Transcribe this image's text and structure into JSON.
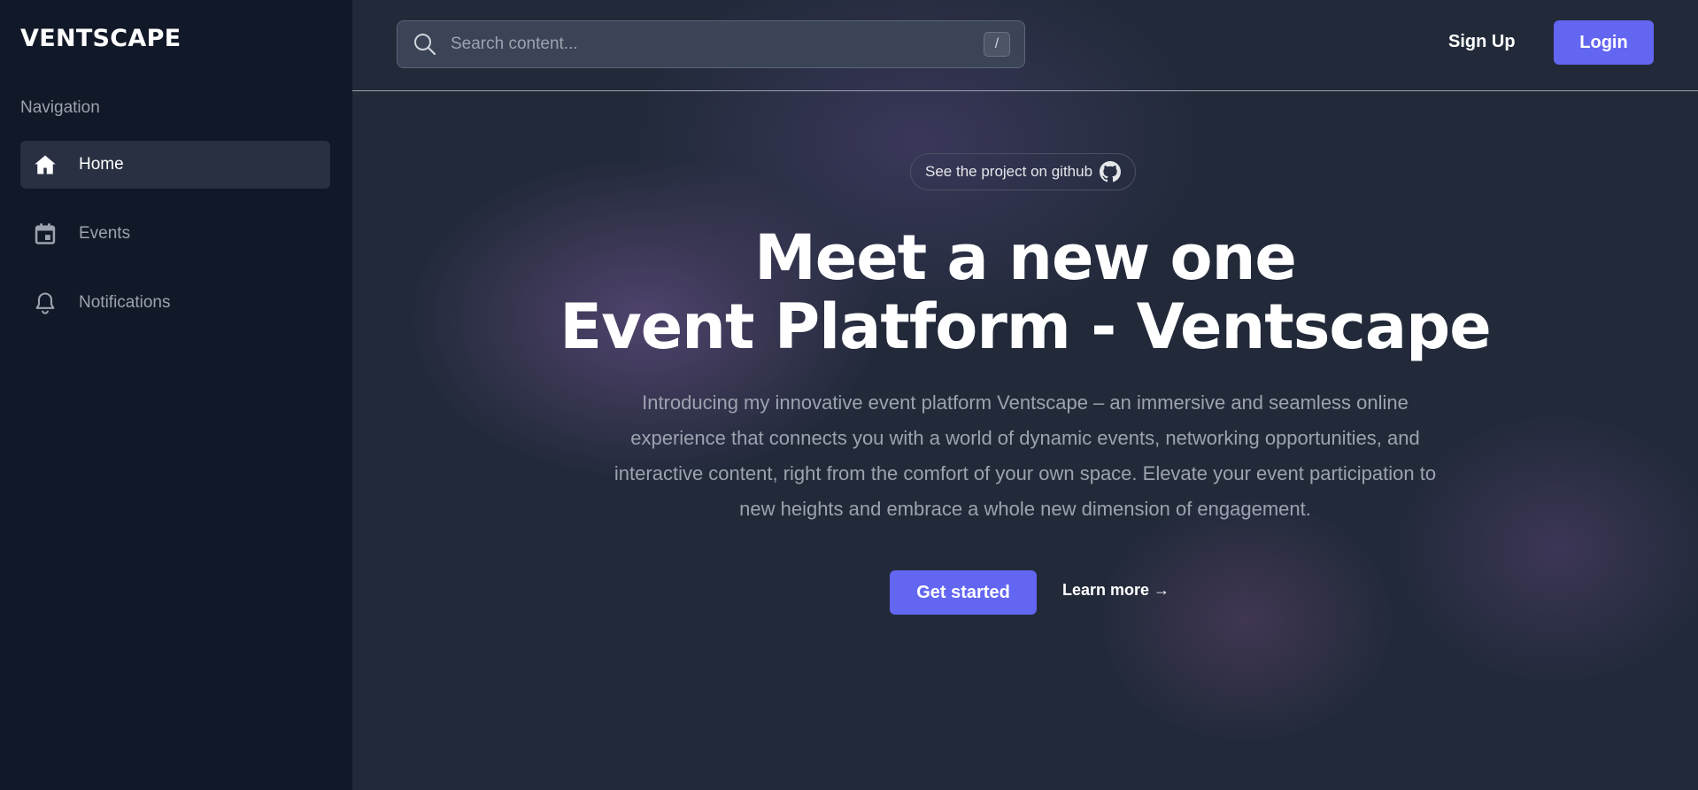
{
  "app": {
    "logo": "VENTSCAPE"
  },
  "sidebar": {
    "heading": "Navigation",
    "items": [
      {
        "label": "Home",
        "icon": "home-icon",
        "active": true
      },
      {
        "label": "Events",
        "icon": "calendar-icon",
        "active": false
      },
      {
        "label": "Notifications",
        "icon": "bell-icon",
        "active": false
      }
    ]
  },
  "header": {
    "search_placeholder": "Search content...",
    "search_shortcut": "/",
    "signup_label": "Sign Up",
    "login_label": "Login"
  },
  "hero": {
    "pill_label": "See the project on github",
    "headline_line1": "Meet a new one",
    "headline_line2": "Event Platform - Ventscape",
    "description_lines": [
      "Introducing my innovative event platform Ventscape – an immersive and seamless online",
      "experience that connects you with a world of dynamic events, networking opportunities, and",
      "interactive content, right from the comfort of your own space. Elevate your event participation to",
      "new heights and embrace a whole new dimension of engagement."
    ],
    "primary_cta": "Get started",
    "secondary_cta": "Learn more →"
  },
  "colors": {
    "accent": "#6366f1",
    "sidebar_bg": "#111827",
    "main_bg": "#222a3a",
    "muted_text": "#9ca3af"
  }
}
